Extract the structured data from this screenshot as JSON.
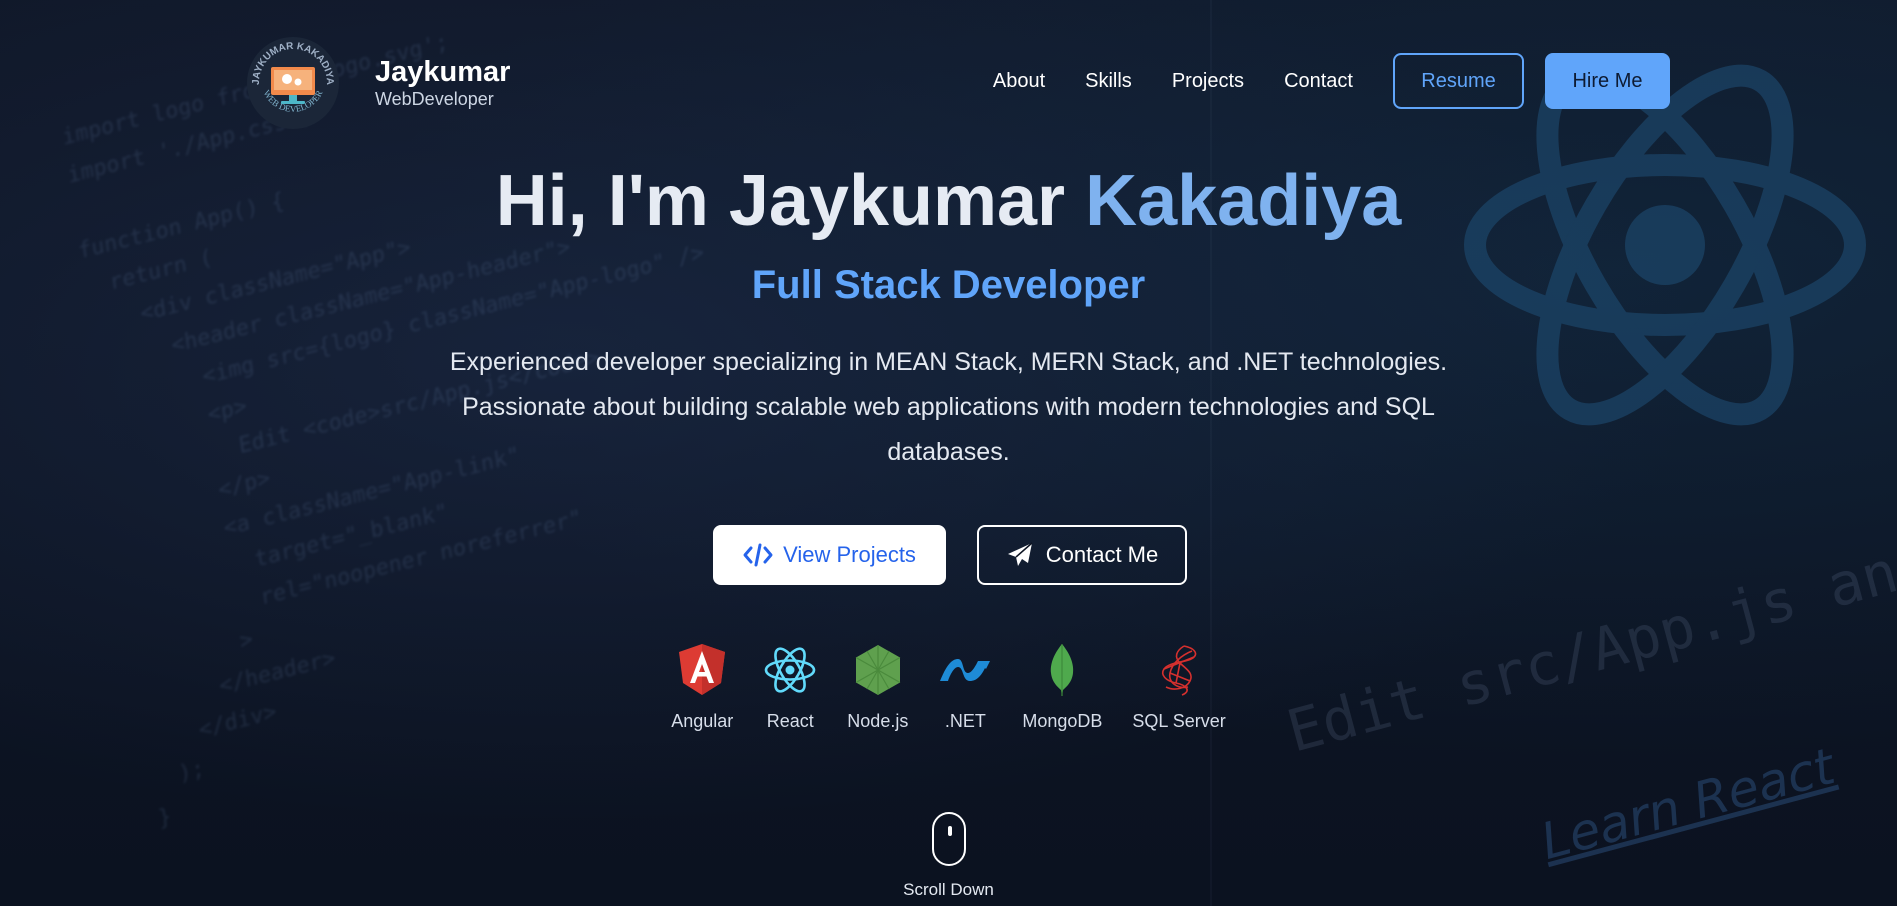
{
  "header": {
    "logo_text": "JAYKUMAR KAKADIYA · WEB DEVELOPER",
    "brand_name": "Jaykumar",
    "brand_subtitle": "WebDeveloper",
    "nav": [
      "About",
      "Skills",
      "Projects",
      "Contact"
    ],
    "resume_label": "Resume",
    "hire_label": "Hire Me"
  },
  "hero": {
    "greeting": "Hi, I'm Jaykumar",
    "surname": "Kakadiya",
    "role": "Full Stack Developer",
    "description": "Experienced developer specializing in MEAN Stack, MERN Stack, and .NET technologies. Passionate about building scalable web applications with modern technologies and SQL databases.",
    "view_projects_label": "View Projects",
    "contact_label": "Contact Me"
  },
  "tech": [
    {
      "label": "Angular",
      "icon": "angular-icon"
    },
    {
      "label": "React",
      "icon": "react-icon"
    },
    {
      "label": "Node.js",
      "icon": "nodejs-icon"
    },
    {
      "label": ".NET",
      "icon": "dotnet-icon"
    },
    {
      "label": "MongoDB",
      "icon": "mongodb-icon"
    },
    {
      "label": "SQL Server",
      "icon": "sqlserver-icon"
    }
  ],
  "scroll_label": "Scroll Down",
  "background": {
    "edit_text": "Edit src/App.js and save to rel",
    "learn_text": "Learn React"
  },
  "colors": {
    "accent": "#60a5fa",
    "background": "#0c1322",
    "view_projects_text": "#2563eb"
  }
}
